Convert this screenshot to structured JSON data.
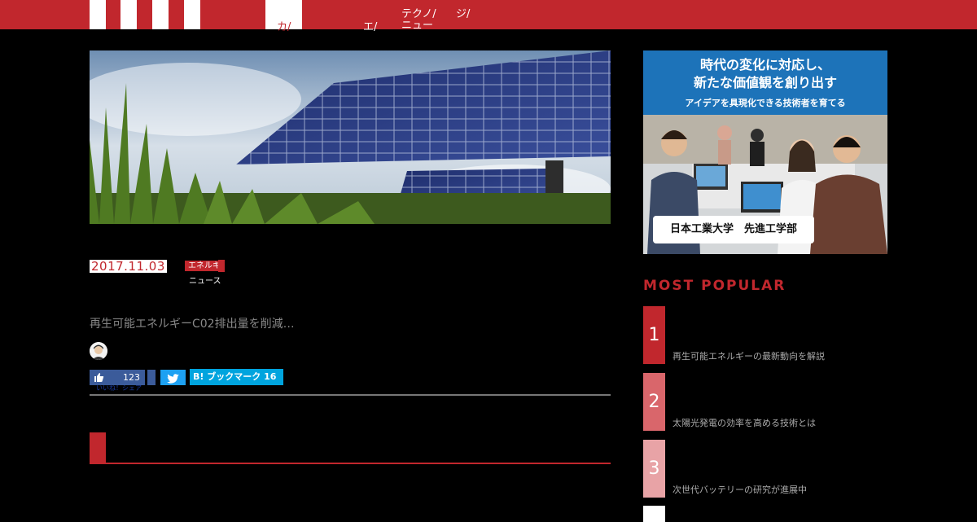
{
  "header": {
    "nav_active": "カ/",
    "nav_items": [
      "エ/",
      "テクノ/",
      "ジ/"
    ],
    "nav_sub": "ニュー"
  },
  "article": {
    "date": "2017.11.03",
    "category": "エネルギ",
    "sub_category": "ニュース",
    "excerpt": "再生可能エネルギーC02排出量を削減…"
  },
  "share": {
    "fb_count": "123",
    "fb_under": "いいね！シェア",
    "hatena_label": "ブックマーク",
    "hatena_count": "16",
    "hatena_mark": "B!"
  },
  "ad": {
    "line1": "時代の変化に対応し、",
    "line2": "新たな価値観を創り出す",
    "line3": "アイデアを具現化できる技術者を育てる",
    "label": "日本工業大学　先進工学部"
  },
  "sidebar": {
    "most_popular_title": "MOST POPULAR",
    "ranks": [
      {
        "num": "1",
        "text": "再生可能エネルギーの最新動向を解説",
        "color": "#c1272d"
      },
      {
        "num": "2",
        "text": "太陽光発電の効率を高める技術とは",
        "color": "#d9666b"
      },
      {
        "num": "3",
        "text": "次世代バッテリーの研究が進展中",
        "color": "#e8a3a6"
      }
    ]
  },
  "colors": {
    "accent": "#c1272d",
    "facebook": "#3b5b9a",
    "twitter": "#1da1f2",
    "hatena": "#00a4de"
  },
  "icons": {
    "thumb": "thumbs-up-icon",
    "twitter": "twitter-bird-icon"
  }
}
